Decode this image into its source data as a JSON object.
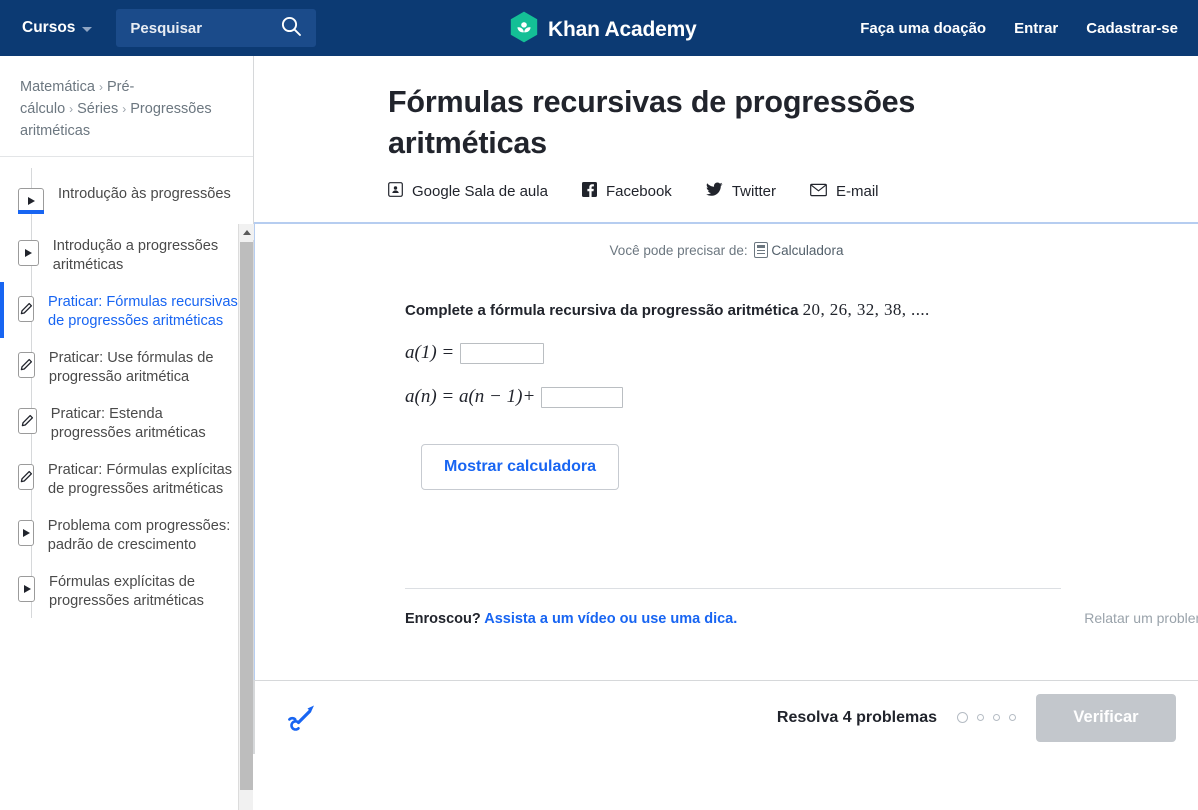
{
  "topnav": {
    "courses_label": "Cursos",
    "search_placeholder": "Pesquisar",
    "search_value": "",
    "brand": "Khan Academy",
    "donate_label": "Faça uma doação",
    "login_label": "Entrar",
    "signup_label": "Cadastrar-se",
    "bg_color": "#0c3a73",
    "logo_color": "#14bf96"
  },
  "breadcrumb": {
    "items": [
      {
        "label": "Matemática"
      },
      {
        "label": "Pré-cálculo"
      },
      {
        "label": "Séries"
      },
      {
        "label": "Progressões aritméticas"
      }
    ],
    "separator": "›"
  },
  "sidebar": {
    "items": [
      {
        "label": "Introdução às progressões",
        "icon": "play-icon",
        "kind": "video",
        "active": false,
        "progress": "completed"
      },
      {
        "label": "Introdução a progressões aritméticas",
        "icon": "play-icon",
        "kind": "video",
        "active": false,
        "progress": "none"
      },
      {
        "label": "Praticar: Fórmulas recursivas de progressões aritméticas",
        "icon": "pencil-icon",
        "kind": "exercise",
        "active": true,
        "progress": "none"
      },
      {
        "label": "Praticar: Use fórmulas de progressão aritmética",
        "icon": "pencil-icon",
        "kind": "exercise",
        "active": false,
        "progress": "none"
      },
      {
        "label": "Praticar: Estenda progressões aritméticas",
        "icon": "pencil-icon",
        "kind": "exercise",
        "active": false,
        "progress": "none"
      },
      {
        "label": "Praticar: Fórmulas explícitas de progressões aritméticas",
        "icon": "pencil-icon",
        "kind": "exercise",
        "active": false,
        "progress": "none"
      },
      {
        "label": "Problema com progressões: padrão de crescimento",
        "icon": "play-icon",
        "kind": "video",
        "active": false,
        "progress": "none"
      },
      {
        "label": "Fórmulas explícitas de progressões aritméticas",
        "icon": "play-icon",
        "kind": "video",
        "active": false,
        "progress": "none"
      }
    ]
  },
  "article": {
    "title": "Fórmulas recursivas de progressões aritméticas",
    "share": [
      {
        "label": "Google Sala de aula",
        "icon": "google-classroom-icon"
      },
      {
        "label": "Facebook",
        "icon": "facebook-icon"
      },
      {
        "label": "Twitter",
        "icon": "twitter-icon"
      },
      {
        "label": "E-mail",
        "icon": "email-icon"
      }
    ]
  },
  "exercise": {
    "calculator_hint_prefix": "Você pode precisar de:",
    "calculator_label": "Calculadora",
    "problem_prefix": "Complete a fórmula recursiva da progressão aritmética",
    "sequence": "20, 26, 32, 38, ....",
    "formula_line1_lhs": "a(1) =",
    "formula_line2_lhs": "a(n) = a(n − 1)+",
    "answer1_value": "",
    "answer2_value": "",
    "show_calculator_label": "Mostrar calculadora",
    "stuck_label": "Enroscou?",
    "stuck_link": "Assista a um vídeo ou use uma dica.",
    "report_label": "Relatar um problema",
    "accent_color": "#1865f2"
  },
  "footer": {
    "doodle_icon": "scratchpad-pen-icon",
    "task_label": "Resolva 4 problemas",
    "progress_dots": 4,
    "current_dot_index": 0,
    "check_label": "Verificar",
    "check_disabled": true
  }
}
